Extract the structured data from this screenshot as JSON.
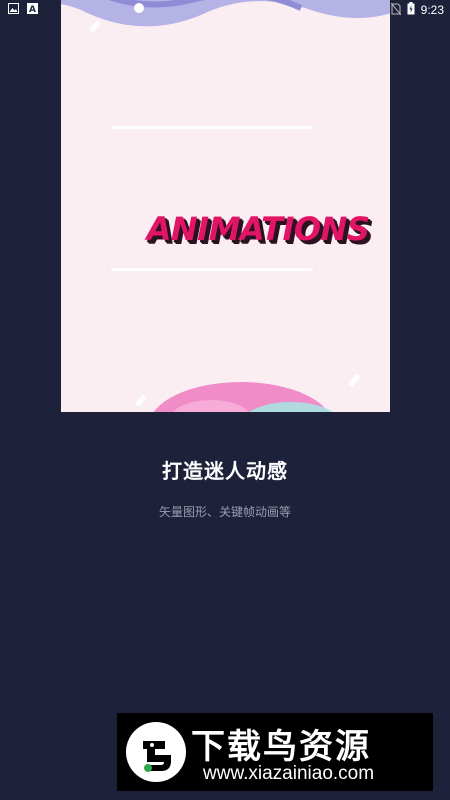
{
  "status_bar": {
    "time": "9:23",
    "left_icons": [
      "image-icon",
      "font-icon"
    ],
    "right_icons": [
      "wifi-icon",
      "battery-icon"
    ]
  },
  "preview": {
    "title": "ANIMATIONS",
    "colors": {
      "background": "#fbeef2",
      "title": "#e21466",
      "title_shadow": "#2a1220"
    }
  },
  "onboarding": {
    "headline": "打造迷人动感",
    "subline": "矢量图形、关键帧动画等"
  },
  "watermark": {
    "title": "下载鸟资源",
    "url": "www.xiazainiao.com"
  },
  "colors": {
    "page_background": "#1e213a",
    "subtitle": "#9a9db0"
  }
}
